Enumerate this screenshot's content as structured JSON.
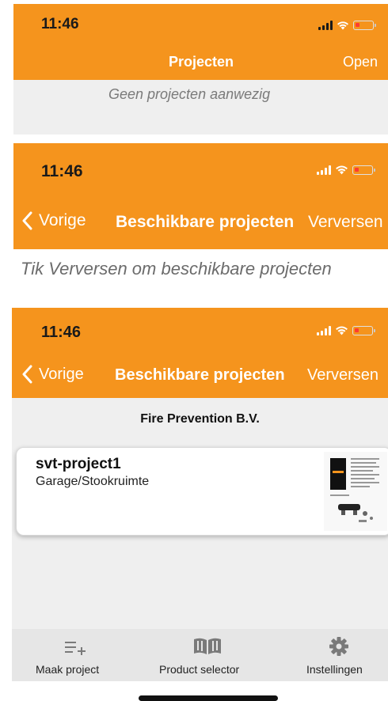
{
  "status_bar": {
    "time": "11:46"
  },
  "screen1": {
    "title": "Projecten",
    "right_button": "Open",
    "empty_message": "Geen projecten aanwezig"
  },
  "screen2": {
    "back_label": "Vorige",
    "title": "Beschikbare projecten",
    "right_button": "Verversen",
    "hint": "Tik Verversen om beschikbare projecten"
  },
  "screen3": {
    "back_label": "Vorige",
    "title": "Beschikbare projecten",
    "right_button": "Verversen",
    "section_title": "Fire Prevention B.V.",
    "projects": [
      {
        "name": "svt-project1",
        "subtitle": "Garage/Stookruimte",
        "thumbnail_icon": "product-manual-thumbnail"
      }
    ]
  },
  "tabbar": {
    "items": [
      {
        "label": "Maak project",
        "icon": "add-list-icon"
      },
      {
        "label": "Product selector",
        "icon": "book-icon"
      },
      {
        "label": "Instellingen",
        "icon": "gear-icon"
      }
    ]
  },
  "colors": {
    "accent": "#f5941d",
    "background": "#efefef",
    "battery_low": "#ff3b30"
  }
}
